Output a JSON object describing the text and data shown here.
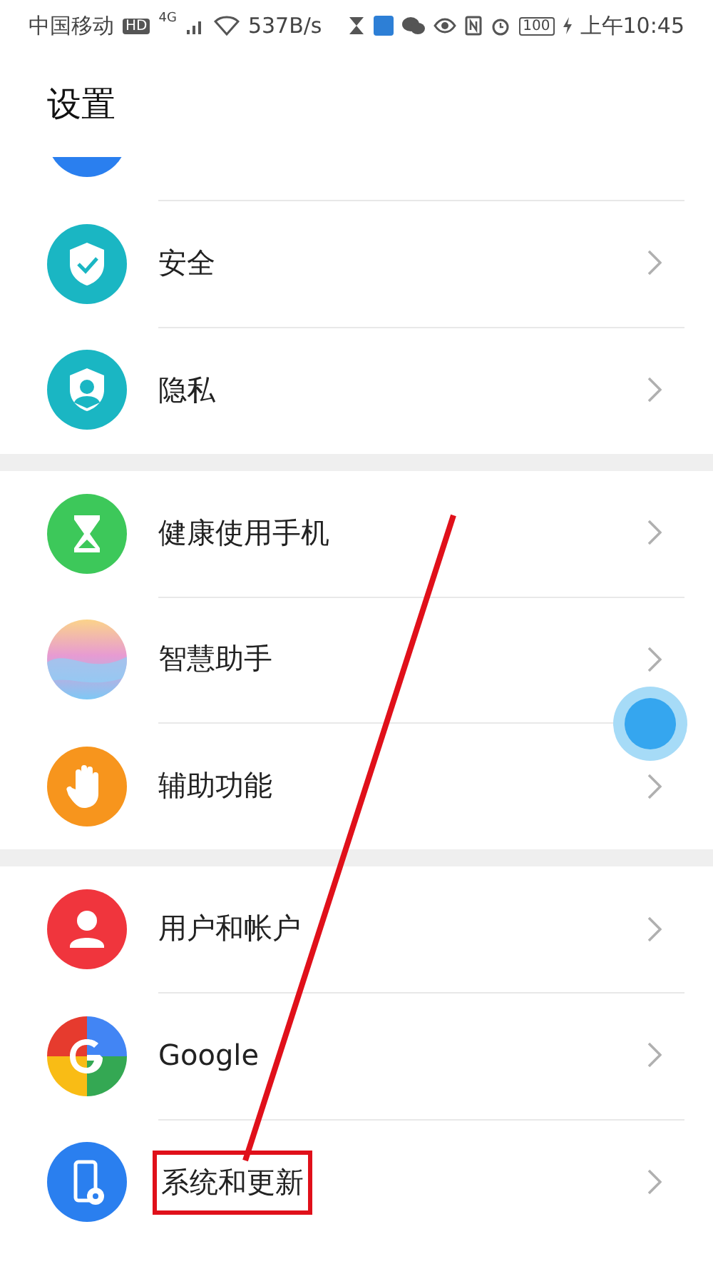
{
  "status_bar": {
    "carrier": "中国移动",
    "hd": "HD",
    "network": "4G",
    "speed": "537B/s",
    "battery": "100",
    "time": "上午10:45"
  },
  "title": "设置",
  "groups": [
    {
      "items": [
        {
          "kind": "cut-off"
        },
        {
          "kind": "security",
          "label": "安全"
        },
        {
          "kind": "privacy",
          "label": "隐私"
        }
      ]
    },
    {
      "items": [
        {
          "kind": "digital-balance",
          "label": "健康使用手机"
        },
        {
          "kind": "assistant",
          "label": "智慧助手"
        },
        {
          "kind": "accessibility",
          "label": "辅助功能"
        }
      ]
    },
    {
      "items": [
        {
          "kind": "users",
          "label": "用户和帐户"
        },
        {
          "kind": "google",
          "label": "Google"
        },
        {
          "kind": "system",
          "label": "系统和更新",
          "highlighted": true
        }
      ]
    }
  ]
}
